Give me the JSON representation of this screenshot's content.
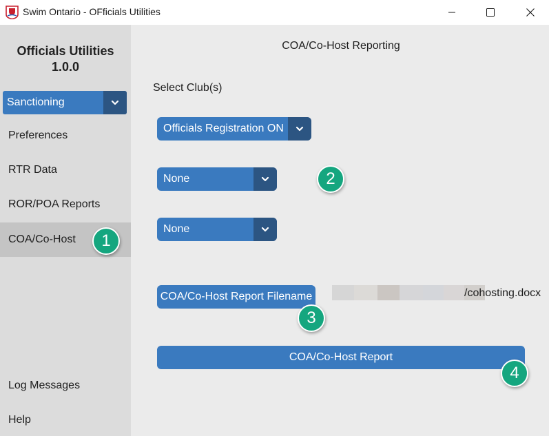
{
  "window": {
    "title": "Swim Ontario - OFficials Utilities",
    "minimize_icon": "minimize-icon",
    "maximize_icon": "maximize-icon",
    "close_icon": "close-icon"
  },
  "sidebar": {
    "app_name": "Officials Utilities",
    "version": "1.0.0",
    "section_select": "Sanctioning",
    "items": [
      {
        "label": "Preferences",
        "active": false
      },
      {
        "label": "RTR Data",
        "active": false
      },
      {
        "label": "ROR/POA Reports",
        "active": false
      },
      {
        "label": "COA/Co-Host",
        "active": true
      }
    ],
    "bottom_items": [
      {
        "label": "Log Messages"
      },
      {
        "label": "Help"
      }
    ]
  },
  "main": {
    "title": "COA/Co-Host Reporting",
    "select_clubs_label": "Select Club(s)",
    "club_selects": [
      {
        "value": "Officials Registration ON"
      },
      {
        "value": "None"
      },
      {
        "value": "None"
      }
    ],
    "filename_button": "COA/Co-Host Report Filename",
    "filename_suffix": "/cohosting.docx",
    "report_button": "COA/Co-Host Report"
  },
  "callouts": [
    "1",
    "2",
    "3",
    "4"
  ],
  "colors": {
    "accent": "#3a7abf",
    "accent_dark": "#2c5582",
    "callout": "#15a67f",
    "sidebar_bg": "#dcdcdc",
    "main_bg": "#ebebeb"
  }
}
